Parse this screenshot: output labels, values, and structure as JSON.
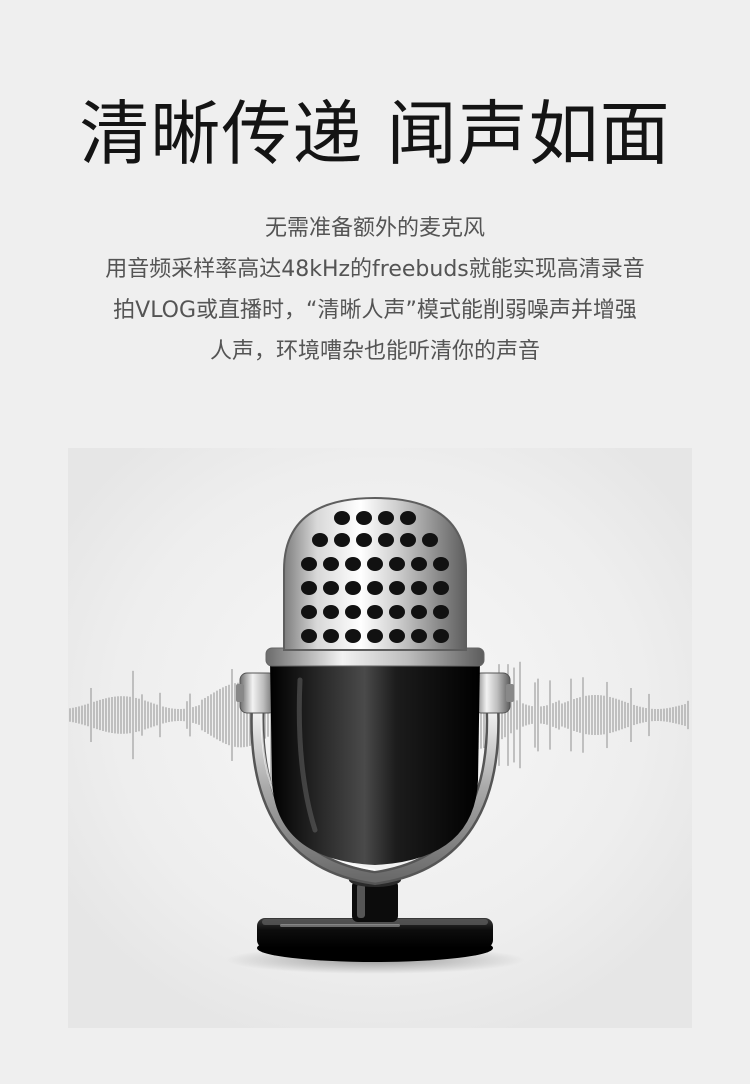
{
  "headline": "清晰传递 闻声如面",
  "description": [
    "无需准备额外的麦克风",
    "用音频采样率高达48kHz的freebuds就能实现高清录音",
    "拍VLOG或直播时，“清晰人声”模式能削弱噪声并增强",
    "人声，环境嘈杂也能听清你的声音"
  ],
  "illustration": {
    "icon": "microphone-icon",
    "waveform": "sound-wave",
    "colors": {
      "background": "#efefef",
      "wave": "#a8a8a8",
      "mic_body": "#111111",
      "mic_chrome": "#c9c9c9"
    }
  }
}
